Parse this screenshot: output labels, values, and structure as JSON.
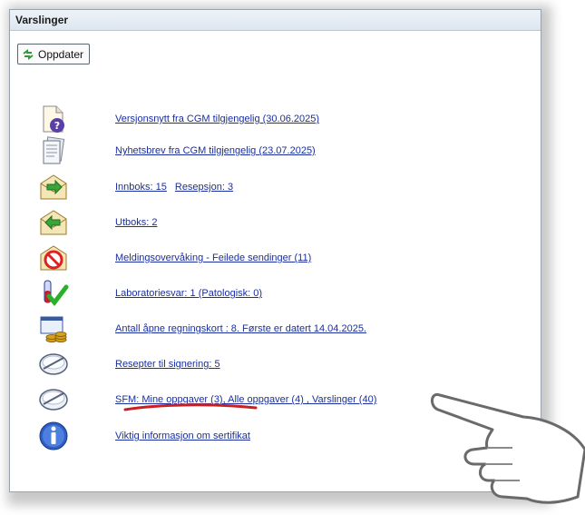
{
  "window": {
    "title": "Varslinger"
  },
  "toolbar": {
    "refresh_label": "Oppdater",
    "refresh_icon": "refresh-icon"
  },
  "notifications": [
    {
      "icon": "question-document-icon",
      "links": [
        "Versjonsnytt fra CGM tilgjengelig (30.06.2025)"
      ]
    },
    {
      "icon": "newsletter-icon",
      "links": [
        "Nyhetsbrev fra CGM tilgjengelig (23.07.2025)"
      ]
    },
    {
      "icon": "inbox-envelope-icon",
      "links": [
        "Innboks: 15",
        "Resepsjon: 3"
      ]
    },
    {
      "icon": "outbox-envelope-icon",
      "links": [
        "Utboks: 2"
      ]
    },
    {
      "icon": "failed-envelope-icon",
      "links": [
        "Meldingsovervåking - Feilede sendinger (11)"
      ]
    },
    {
      "icon": "lab-tube-check-icon",
      "links": [
        "Laboratoriesvar: 1 (Patologisk: 0)"
      ]
    },
    {
      "icon": "billing-card-coins-icon",
      "links": [
        "Antall åpne regningskort :  8. Første er datert 14.04.2025."
      ]
    },
    {
      "icon": "pill-icon",
      "links": [
        "Resepter til signering: 5"
      ]
    },
    {
      "icon": "pill-icon",
      "links": [
        "SFM: Mine oppgaver (3), Alle oppgaver (4) , Varslinger (40)"
      ]
    },
    {
      "icon": "info-icon",
      "links": [
        "Viktig informasjon om sertifikat"
      ]
    }
  ],
  "colors": {
    "link": "#1a2fa0",
    "annotation_underline": "#cc1f1f"
  }
}
